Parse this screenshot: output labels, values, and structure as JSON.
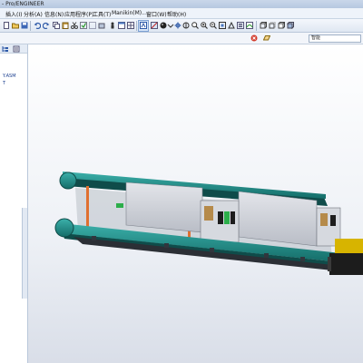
{
  "app": {
    "title": "- Pro/ENGINEER"
  },
  "menu": {
    "items": [
      {
        "label": "插入(I)"
      },
      {
        "label": "分析(A)"
      },
      {
        "label": "信息(N)"
      },
      {
        "label": "应用程序(P)"
      },
      {
        "label": "工具(T)"
      },
      {
        "label": "Manikin(M)..."
      },
      {
        "label": "窗口(W)"
      },
      {
        "label": "帮助(H)"
      }
    ]
  },
  "filter": {
    "label": "智能"
  },
  "model_tree": {
    "items": [
      {
        "label": "Y.ASM"
      },
      {
        "label": "T"
      }
    ]
  },
  "icons": [
    "new-icon",
    "open-icon",
    "save-icon",
    "print-icon",
    "undo-icon",
    "redo-icon",
    "regenerate-icon",
    "spin-icon",
    "zoom-in-icon",
    "zoom-out-icon",
    "refit-icon",
    "shading-icon",
    "datum-icon"
  ],
  "colors": {
    "rail": "#1f8f8a",
    "plate": "#c9ccd3",
    "belt_post": "#e07030",
    "motor": "#d7b400"
  }
}
